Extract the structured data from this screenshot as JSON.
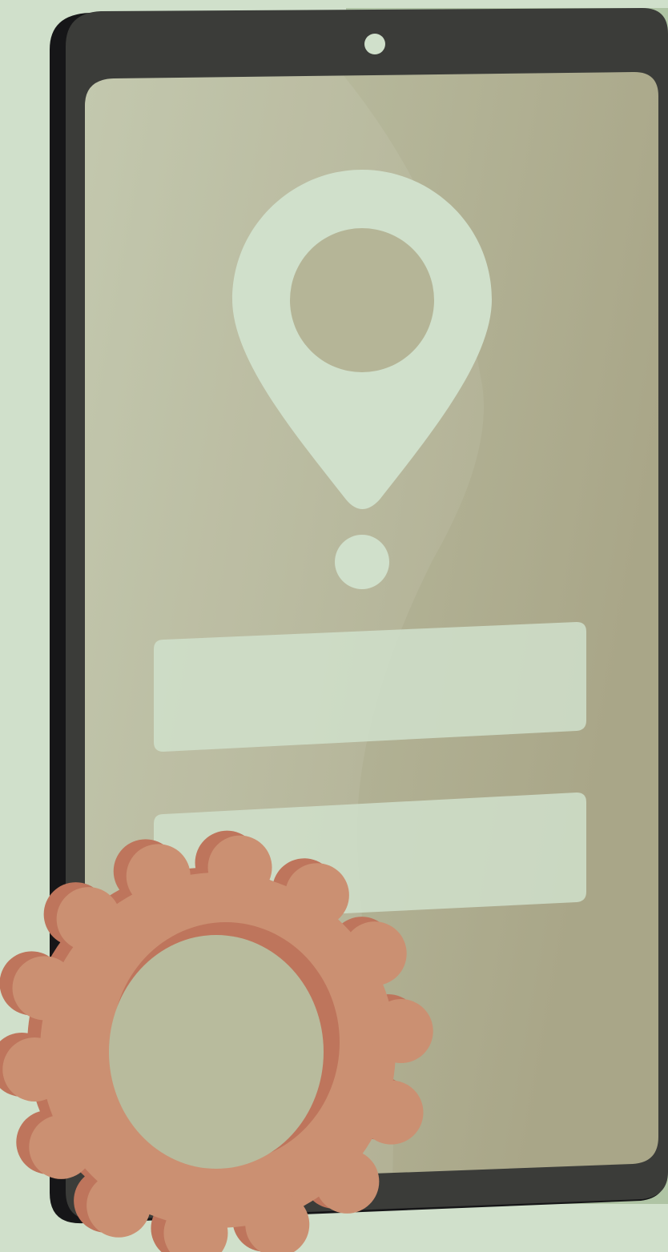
{
  "scene": {
    "background_color": "#D0E0CB",
    "backdrop_panel_color": "#AFC4A4",
    "phone": {
      "body_color": "#3B3C39",
      "body_side_color": "#161618",
      "camera_color": "#D0E0CB",
      "screen_color_light": "#BFC4A8",
      "screen_color_dark": "#A9A688"
    },
    "location_pin": {
      "icon": "location-pin-icon",
      "color": "#D0E0CB",
      "hole_color": "#B5B597"
    },
    "form_fields": [
      {
        "name": "text-field-1",
        "color": "#D0E0CB"
      },
      {
        "name": "text-field-2",
        "color": "#D0E0CB"
      }
    ],
    "gear": {
      "icon": "gear-icon",
      "face_color": "#CB9072",
      "shadow_color": "#BE755C",
      "teeth_count": 14
    }
  }
}
